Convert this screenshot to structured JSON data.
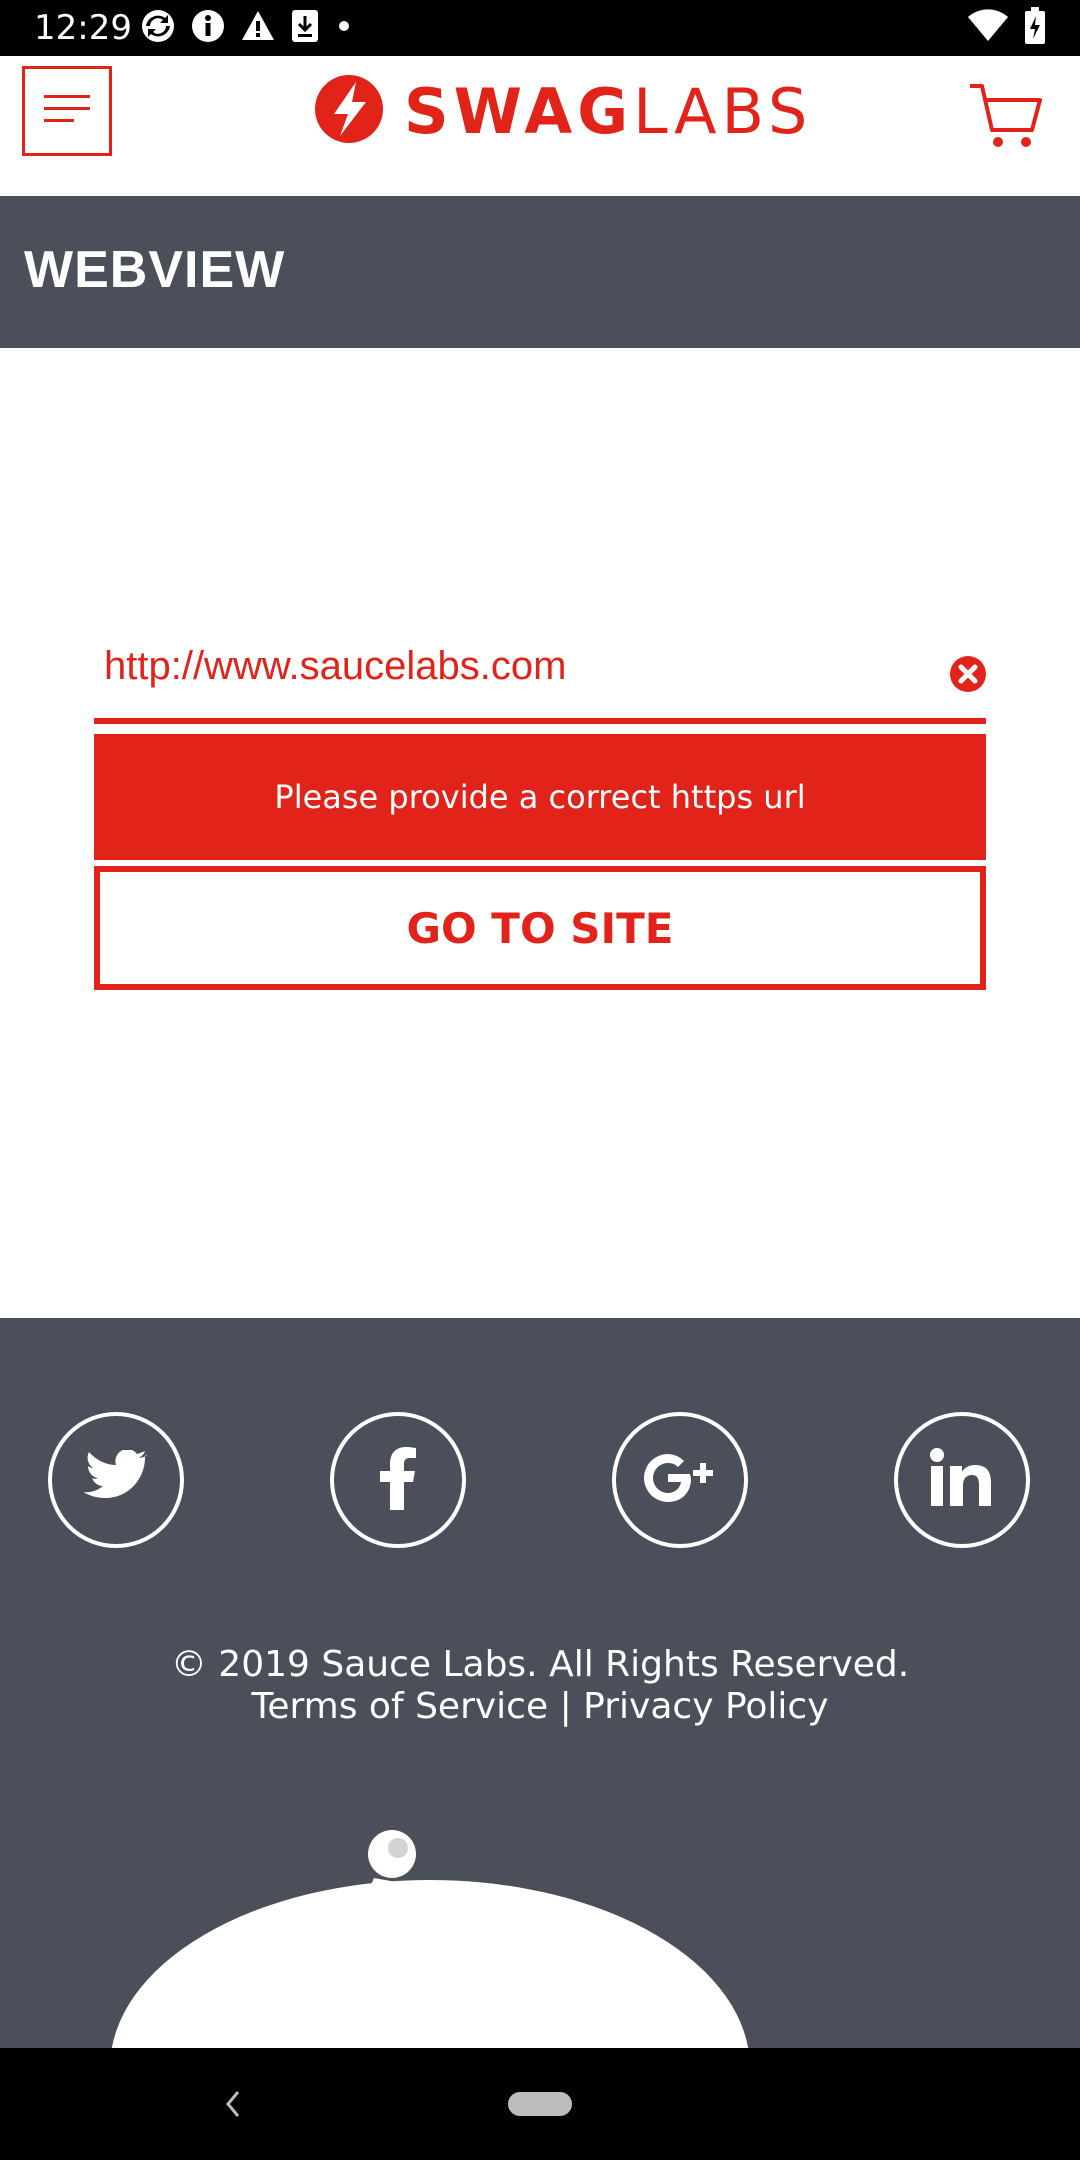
{
  "status_bar": {
    "time": "12:29",
    "left_icons": [
      "sync-icon",
      "info-icon",
      "warning-icon",
      "download-icon",
      "dot-icon"
    ],
    "right_icons": [
      "wifi-icon",
      "battery-icon"
    ]
  },
  "header": {
    "menu_icon": "hamburger-menu-icon",
    "logo_bold": "SWAG",
    "logo_light": "LABS",
    "cart_icon": "cart-icon",
    "brand_color": "#e2231a"
  },
  "page": {
    "title": "WEBVIEW"
  },
  "form": {
    "url_value": "http://www.saucelabs.com",
    "clear_icon": "clear-icon",
    "error_message": "Please provide a correct https url",
    "go_button_label": "GO TO SITE"
  },
  "footer": {
    "social": [
      {
        "name": "twitter-icon"
      },
      {
        "name": "facebook-icon"
      },
      {
        "name": "google-plus-icon"
      },
      {
        "name": "linkedin-icon"
      }
    ],
    "copyright": "© 2019 Sauce Labs. All Rights Reserved.",
    "terms_label": "Terms of Service",
    "separator": "|",
    "privacy_label": "Privacy Policy",
    "background_color": "#4a4f59"
  },
  "nav_bar": {
    "back_icon": "back-icon",
    "home_icon": "home-pill-icon"
  }
}
